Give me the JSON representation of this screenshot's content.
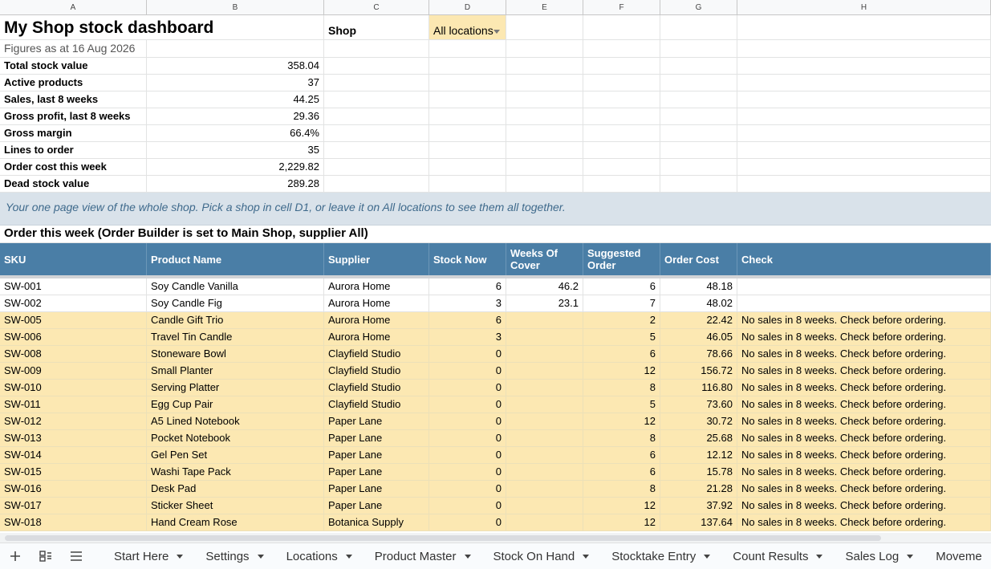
{
  "columns": [
    "A",
    "B",
    "C",
    "D",
    "E",
    "F",
    "G",
    "H"
  ],
  "header": {
    "title": "My Shop stock dashboard",
    "shop_label": "Shop",
    "shop_dropdown": "All locations",
    "as_at": "Figures as at 16 Aug 2026"
  },
  "metrics": [
    {
      "label": "Total stock value",
      "value": "358.04"
    },
    {
      "label": "Active products",
      "value": "37"
    },
    {
      "label": "Sales, last 8 weeks",
      "value": "44.25"
    },
    {
      "label": "Gross profit, last 8 weeks",
      "value": "29.36"
    },
    {
      "label": "Gross margin",
      "value": "66.4%"
    },
    {
      "label": "Lines to order",
      "value": "35"
    },
    {
      "label": "Order cost this week",
      "value": "2,229.82"
    },
    {
      "label": "Dead stock value",
      "value": "289.28"
    }
  ],
  "note": "Your one page view of the whole shop. Pick a shop in cell D1, or leave it on All locations to see them all together.",
  "section_title": "Order this week (Order Builder is set to Main Shop, supplier All)",
  "table_headers": [
    "SKU",
    "Product Name",
    "Supplier",
    "Stock Now",
    "Weeks Of Cover",
    "Suggested Order",
    "Order Cost",
    "Check"
  ],
  "rows": [
    {
      "sku": "SW-001",
      "name": "Soy Candle Vanilla",
      "supplier": "Aurora Home",
      "stock": "6",
      "cover": "46.2",
      "order": "6",
      "cost": "48.18",
      "check": "",
      "flag": false
    },
    {
      "sku": "SW-002",
      "name": "Soy Candle Fig",
      "supplier": "Aurora Home",
      "stock": "3",
      "cover": "23.1",
      "order": "7",
      "cost": "48.02",
      "check": "",
      "flag": false
    },
    {
      "sku": "SW-005",
      "name": "Candle Gift Trio",
      "supplier": "Aurora Home",
      "stock": "6",
      "cover": "",
      "order": "2",
      "cost": "22.42",
      "check": "No sales in 8 weeks. Check before ordering.",
      "flag": true
    },
    {
      "sku": "SW-006",
      "name": "Travel Tin Candle",
      "supplier": "Aurora Home",
      "stock": "3",
      "cover": "",
      "order": "5",
      "cost": "46.05",
      "check": "No sales in 8 weeks. Check before ordering.",
      "flag": true
    },
    {
      "sku": "SW-008",
      "name": "Stoneware Bowl",
      "supplier": "Clayfield Studio",
      "stock": "0",
      "cover": "",
      "order": "6",
      "cost": "78.66",
      "check": "No sales in 8 weeks. Check before ordering.",
      "flag": true
    },
    {
      "sku": "SW-009",
      "name": "Small Planter",
      "supplier": "Clayfield Studio",
      "stock": "0",
      "cover": "",
      "order": "12",
      "cost": "156.72",
      "check": "No sales in 8 weeks. Check before ordering.",
      "flag": true
    },
    {
      "sku": "SW-010",
      "name": "Serving Platter",
      "supplier": "Clayfield Studio",
      "stock": "0",
      "cover": "",
      "order": "8",
      "cost": "116.80",
      "check": "No sales in 8 weeks. Check before ordering.",
      "flag": true
    },
    {
      "sku": "SW-011",
      "name": "Egg Cup Pair",
      "supplier": "Clayfield Studio",
      "stock": "0",
      "cover": "",
      "order": "5",
      "cost": "73.60",
      "check": "No sales in 8 weeks. Check before ordering.",
      "flag": true
    },
    {
      "sku": "SW-012",
      "name": "A5 Lined Notebook",
      "supplier": "Paper Lane",
      "stock": "0",
      "cover": "",
      "order": "12",
      "cost": "30.72",
      "check": "No sales in 8 weeks. Check before ordering.",
      "flag": true
    },
    {
      "sku": "SW-013",
      "name": "Pocket Notebook",
      "supplier": "Paper Lane",
      "stock": "0",
      "cover": "",
      "order": "8",
      "cost": "25.68",
      "check": "No sales in 8 weeks. Check before ordering.",
      "flag": true
    },
    {
      "sku": "SW-014",
      "name": "Gel Pen Set",
      "supplier": "Paper Lane",
      "stock": "0",
      "cover": "",
      "order": "6",
      "cost": "12.12",
      "check": "No sales in 8 weeks. Check before ordering.",
      "flag": true
    },
    {
      "sku": "SW-015",
      "name": "Washi Tape Pack",
      "supplier": "Paper Lane",
      "stock": "0",
      "cover": "",
      "order": "6",
      "cost": "15.78",
      "check": "No sales in 8 weeks. Check before ordering.",
      "flag": true
    },
    {
      "sku": "SW-016",
      "name": "Desk Pad",
      "supplier": "Paper Lane",
      "stock": "0",
      "cover": "",
      "order": "8",
      "cost": "21.28",
      "check": "No sales in 8 weeks. Check before ordering.",
      "flag": true
    },
    {
      "sku": "SW-017",
      "name": "Sticker Sheet",
      "supplier": "Paper Lane",
      "stock": "0",
      "cover": "",
      "order": "12",
      "cost": "37.92",
      "check": "No sales in 8 weeks. Check before ordering.",
      "flag": true
    },
    {
      "sku": "SW-018",
      "name": "Hand Cream Rose",
      "supplier": "Botanica Supply",
      "stock": "0",
      "cover": "",
      "order": "12",
      "cost": "137.64",
      "check": "No sales in 8 weeks. Check before ordering.",
      "flag": true
    }
  ],
  "sheet_tabs": [
    "Start Here",
    "Settings",
    "Locations",
    "Product Master",
    "Stock On Hand",
    "Stocktake Entry",
    "Count Results",
    "Sales Log",
    "Moveme"
  ],
  "icons": {
    "add": "plus-icon",
    "all_sheets": "sheet-list-icon",
    "menu": "hamburger-icon"
  },
  "colors": {
    "header_blue": "#4a7ea6",
    "highlight": "#fce8b2",
    "note_bg": "#d9e2ea",
    "note_text": "#3f6a8c"
  }
}
